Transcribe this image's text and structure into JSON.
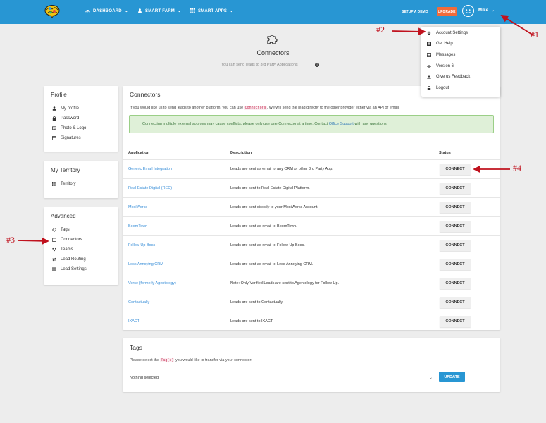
{
  "nav": {
    "dashboard": "DASHBOARD",
    "smart_farm": "SMART FARM",
    "smart_apps": "SMART APPS",
    "setup_demo": "SETUP A DEMO",
    "upgrade": "UPGRADE",
    "user": "Mike"
  },
  "dropdown": {
    "items": [
      "Account Settings",
      "Get Help",
      "Messages",
      "Version 6",
      "Give us Feedback",
      "Logout"
    ]
  },
  "header": {
    "title": "Connectors",
    "subtitle": "You can send leads to 3rd Party Applications"
  },
  "profile": {
    "title": "Profile",
    "items": [
      "My profile",
      "Password",
      "Photo & Logo",
      "Signatures"
    ]
  },
  "territory": {
    "title": "My Territory",
    "items": [
      "Territory"
    ]
  },
  "advanced": {
    "title": "Advanced",
    "items": [
      "Tags",
      "Connectors",
      "Teams",
      "Lead Routing",
      "Lead Settings"
    ]
  },
  "main": {
    "title": "Connectors",
    "intro_before": "If you would like us to send leads to another platform, you can use",
    "intro_code": "Connectors",
    "intro_after": ". We will send the lead directly to the other provider either via an API or email.",
    "alert_before": "Connecting multiple external sources may cause conflicts, please only use one Connector at a time. Contact",
    "alert_link": "Office Support",
    "alert_after": "with any questions.",
    "columns": {
      "application": "Application",
      "description": "Description",
      "status": "Status"
    },
    "connect_label": "CONNECT",
    "rows": [
      {
        "app": "Generic Email Integration",
        "desc": "Leads are sent as email to any CRM or other 3rd Party App."
      },
      {
        "app": "Real Estate Digital (RED)",
        "desc": "Leads are sent to Real Estate Digital Platform."
      },
      {
        "app": "MoxiWorks",
        "desc": "Leads are sent directly to your MoxiWorks Account."
      },
      {
        "app": "BoomTown",
        "desc": "Leads are sent as email to BoomTown."
      },
      {
        "app": "Follow Up Boss",
        "desc": "Leads are sent as email to Follow Up Boss."
      },
      {
        "app": "Less Annoying CRM",
        "desc": "Leads are sent as email to Less Annoying CRM."
      },
      {
        "app": "Verse (formerly Agentology)",
        "desc": "Note: Only Verified Leads are sent to Agentology for Follow Up."
      },
      {
        "app": "Contactually",
        "desc": "Leads are sent to Contactually."
      },
      {
        "app": "IXACT",
        "desc": "Leads are sent to IXACT."
      }
    ]
  },
  "tags": {
    "title": "Tags",
    "text_before": "Please select the",
    "text_code": "Tag(s)",
    "text_after": "you would like to transfer via your connector:",
    "select_value": "Nothing selected",
    "update_label": "UPDATE"
  },
  "annotations": {
    "a1": "#1",
    "a2": "#2",
    "a3": "#3",
    "a4": "#4"
  },
  "colors": {
    "nav": "#2896d3",
    "upgrade": "#f26b3a",
    "link": "#3a8fd8",
    "annotation": "#c0121e",
    "alert_bg": "#dff0d8"
  }
}
